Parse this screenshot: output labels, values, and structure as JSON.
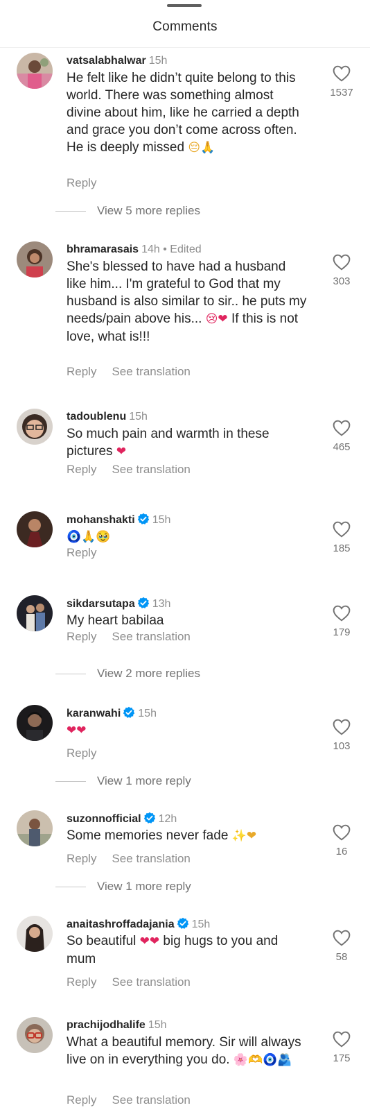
{
  "header": {
    "title": "Comments"
  },
  "comments": [
    {
      "username": "vatsalabhalwar",
      "time": "15h",
      "edited": "",
      "verified": false,
      "text": "He felt like he didn’t quite belong to this world. There was something almost divine about him, like he carried a depth and grace you don’t come across often. He is deeply missed",
      "emoji": "😔🙏",
      "likes": "1537",
      "reply": "Reply",
      "translation": "",
      "more_replies": "View 5 more replies",
      "avatar_icon": "user-photo"
    },
    {
      "username": "bhramarasais",
      "time": "14h",
      "edited": "• Edited",
      "verified": false,
      "text_before": "She's blessed to have had a husband like him... I'm grateful to God that my husband is also similar to sir.. he puts my needs/pain above his...",
      "emoji": "😢❤",
      "text_after": "If this is not love, what is!!!",
      "likes": "303",
      "reply": "Reply",
      "translation": "See translation",
      "more_replies": "",
      "avatar_icon": "user-photo"
    },
    {
      "username": "tadoublenu",
      "time": "15h",
      "edited": "",
      "verified": false,
      "text": "So much pain and warmth in these pictures",
      "emoji": "❤",
      "likes": "465",
      "reply": "Reply",
      "translation": "See translation",
      "more_replies": "",
      "avatar_icon": "user-photo"
    },
    {
      "username": "mohanshakti",
      "time": "15h",
      "edited": "",
      "verified": true,
      "text": "",
      "emoji": "🧿🙏🥹",
      "likes": "185",
      "reply": "Reply",
      "translation": "",
      "more_replies": "",
      "avatar_icon": "user-photo"
    },
    {
      "username": "sikdarsutapa",
      "time": "13h",
      "edited": "",
      "verified": true,
      "text": "My heart babilaa",
      "emoji": "",
      "likes": "179",
      "reply": "Reply",
      "translation": "See translation",
      "more_replies": "View 2 more replies",
      "avatar_icon": "user-photo"
    },
    {
      "username": "karanwahi",
      "time": "15h",
      "edited": "",
      "verified": true,
      "text": "",
      "emoji": "❤❤",
      "likes": "103",
      "reply": "Reply",
      "translation": "",
      "more_replies": "View 1 more reply",
      "avatar_icon": "user-photo"
    },
    {
      "username": "suzonnofficial",
      "time": "12h",
      "edited": "",
      "verified": true,
      "text": "Some memories never fade",
      "emoji": "✨❤",
      "likes": "16",
      "reply": "Reply",
      "translation": "See translation",
      "more_replies": "View 1 more reply",
      "avatar_icon": "user-photo"
    },
    {
      "username": "anaitashroffadajania",
      "time": "15h",
      "edited": "",
      "verified": true,
      "text_before": "So beautiful",
      "emoji": "❤❤",
      "text_after": "big hugs to you and mum",
      "likes": "58",
      "reply": "Reply",
      "translation": "See translation",
      "more_replies": "",
      "avatar_icon": "user-photo"
    },
    {
      "username": "prachijodhalife",
      "time": "15h",
      "edited": "",
      "verified": false,
      "text": "What a beautiful memory. Sir will always live on in everything you do.",
      "emoji": "🌸🫶🧿🫂",
      "likes": "175",
      "reply": "Reply",
      "translation": "See translation",
      "more_replies": "",
      "avatar_icon": "user-photo"
    }
  ],
  "colors": {
    "text": "#262626",
    "muted": "#8e8e8e",
    "verified": "#0095f6",
    "heart_red": "#e0245e"
  },
  "icons": {
    "like": "heart-outline-icon",
    "verified": "verified-badge-icon"
  }
}
